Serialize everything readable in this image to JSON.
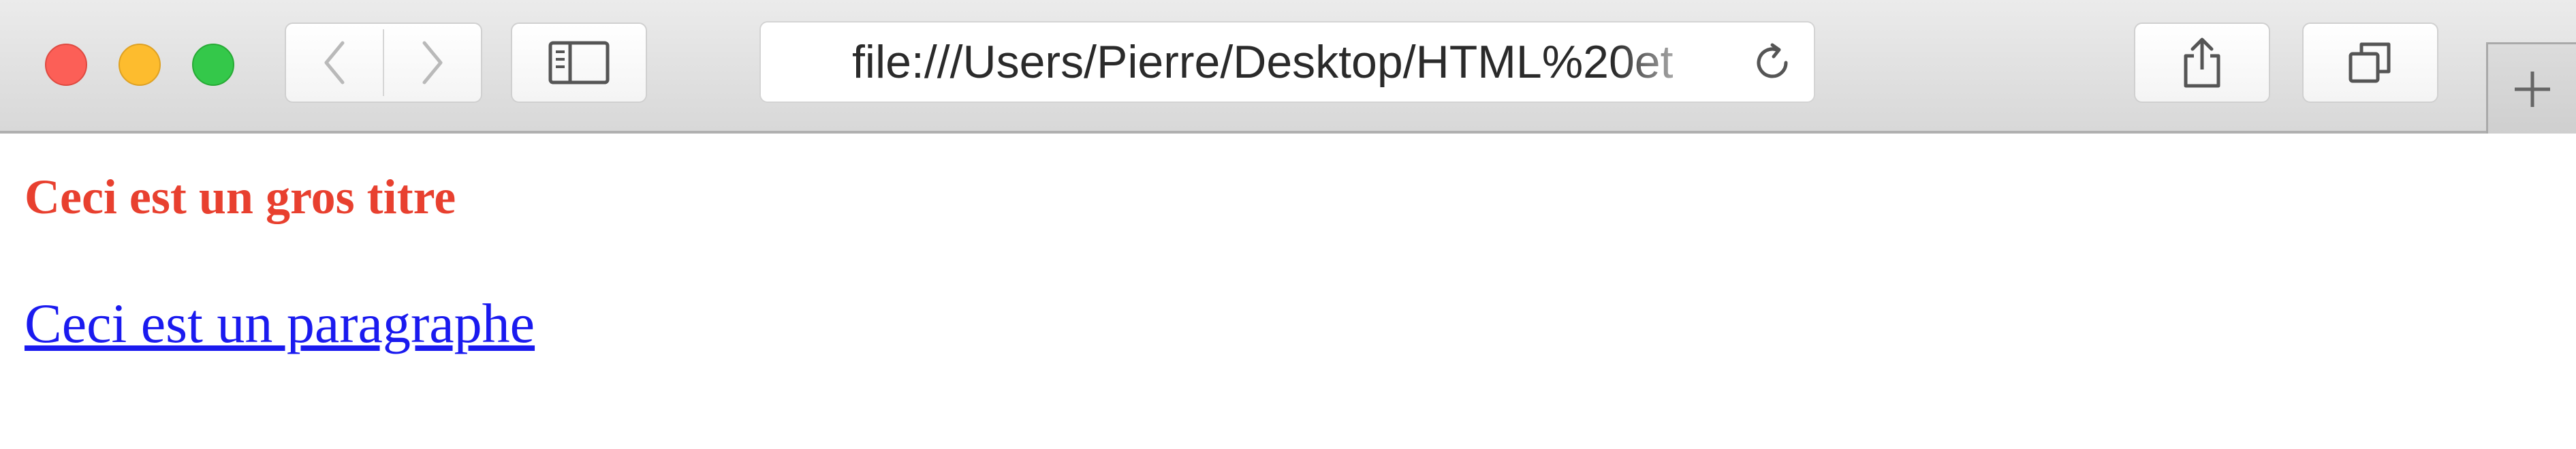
{
  "browser": {
    "url": "file:///Users/Pierre/Desktop/HTML%20et",
    "icons": {
      "back": "chevron-left-icon",
      "forward": "chevron-right-icon",
      "sidebar": "sidebar-icon",
      "reload": "reload-icon",
      "share": "share-icon",
      "tabs": "tab-overview-icon",
      "new_tab": "plus-icon"
    },
    "colors": {
      "close": "#fc5f57",
      "minimize": "#fdbc2e",
      "maximize": "#34c84a"
    }
  },
  "page": {
    "title": "Ceci est un gros titre",
    "paragraph": "Ceci est un paragraphe",
    "colors": {
      "title": "#e8402f",
      "link": "#1a1aef"
    }
  }
}
